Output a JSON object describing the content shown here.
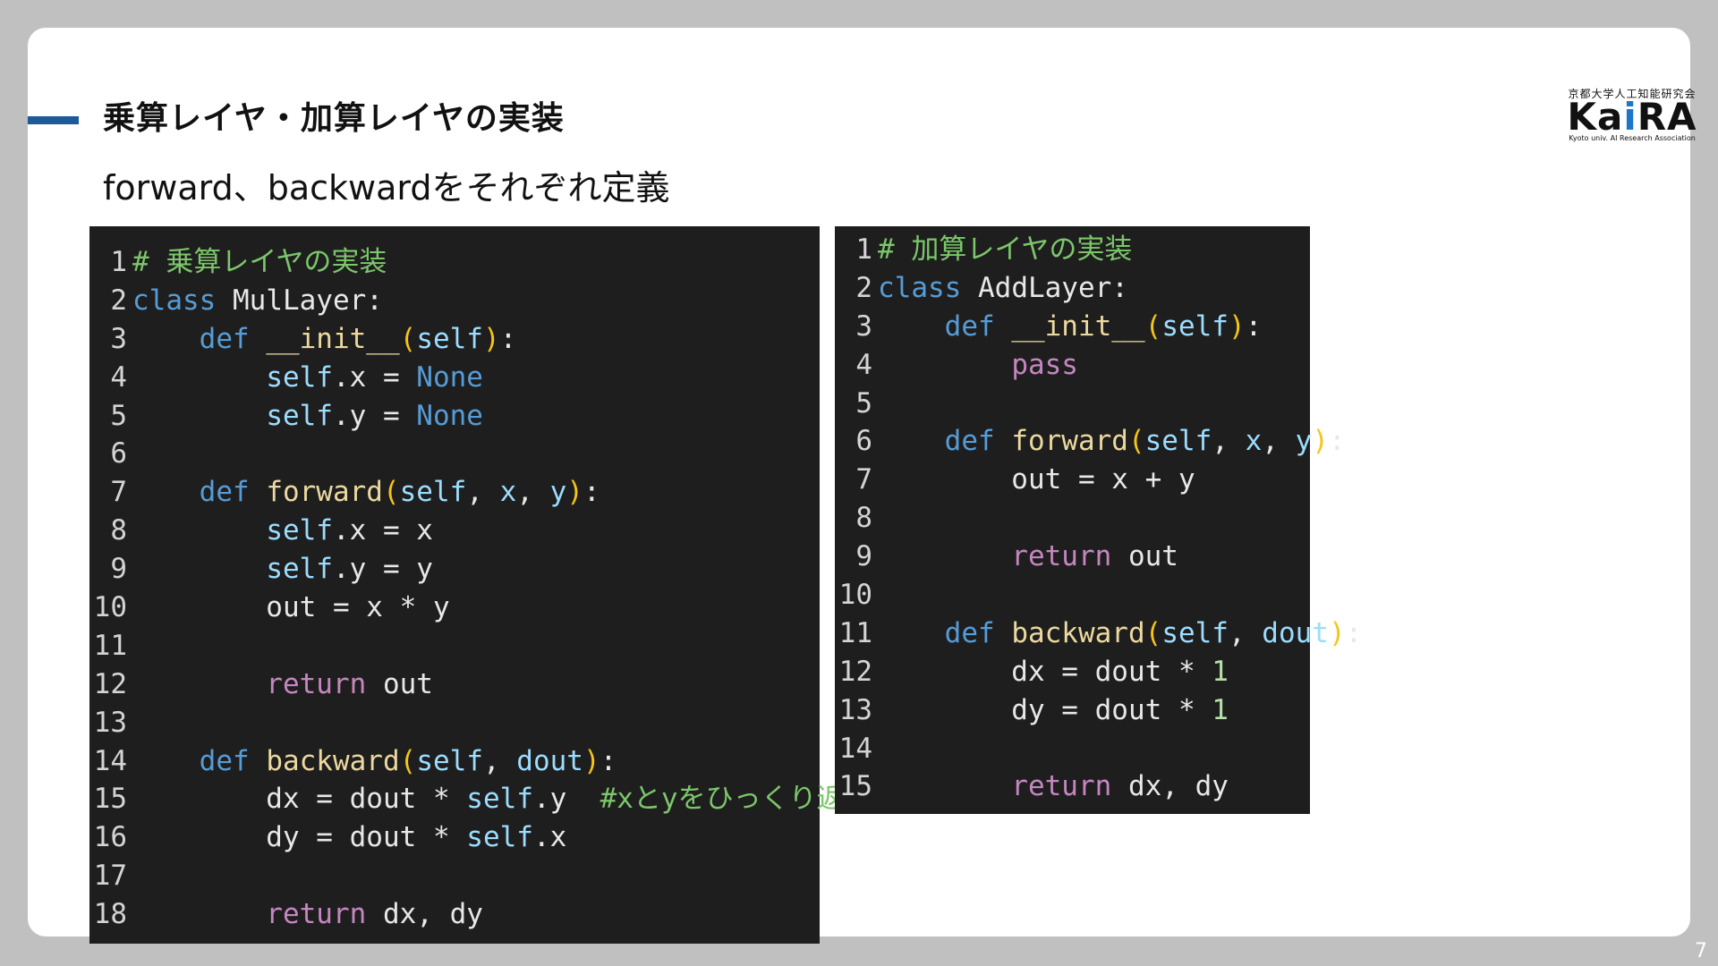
{
  "slide": {
    "title": "乗算レイヤ・加算レイヤの実装",
    "subtitle": "forward、backwardをそれぞれ定義",
    "page_number": "7"
  },
  "logo": {
    "japanese": "京都大学人工知能研究会",
    "main_left": "Ka",
    "main_i": "i",
    "main_right": "RA",
    "english": "Kyoto univ. AI Research Association",
    "accent_color": "#1d78c8"
  },
  "colors": {
    "accent_bar": "#1d5a96",
    "code_background": "#1e1e1e"
  },
  "code_left": {
    "lines": [
      {
        "n": "1",
        "tokens": [
          {
            "t": "# 乗算レイヤの実装",
            "c": "cmt"
          }
        ]
      },
      {
        "n": "2",
        "tokens": [
          {
            "t": "class",
            "c": "kw"
          },
          {
            "t": " MulLayer:",
            "c": "plain"
          }
        ]
      },
      {
        "n": "3",
        "tokens": [
          {
            "t": "    ",
            "c": "plain"
          },
          {
            "t": "def",
            "c": "kw"
          },
          {
            "t": " __init__",
            "c": "fn"
          },
          {
            "t": "(",
            "c": "paren"
          },
          {
            "t": "self",
            "c": "self"
          },
          {
            "t": ")",
            "c": "paren"
          },
          {
            "t": ":",
            "c": "plain"
          }
        ]
      },
      {
        "n": "4",
        "tokens": [
          {
            "t": "        ",
            "c": "plain"
          },
          {
            "t": "self",
            "c": "self"
          },
          {
            "t": ".x = ",
            "c": "plain"
          },
          {
            "t": "None",
            "c": "const"
          }
        ]
      },
      {
        "n": "5",
        "tokens": [
          {
            "t": "        ",
            "c": "plain"
          },
          {
            "t": "self",
            "c": "self"
          },
          {
            "t": ".y = ",
            "c": "plain"
          },
          {
            "t": "None",
            "c": "const"
          }
        ]
      },
      {
        "n": "6",
        "tokens": []
      },
      {
        "n": "7",
        "tokens": [
          {
            "t": "    ",
            "c": "plain"
          },
          {
            "t": "def",
            "c": "kw"
          },
          {
            "t": " forward",
            "c": "fn"
          },
          {
            "t": "(",
            "c": "paren"
          },
          {
            "t": "self",
            "c": "self"
          },
          {
            "t": ", ",
            "c": "plain"
          },
          {
            "t": "x",
            "c": "self"
          },
          {
            "t": ", ",
            "c": "plain"
          },
          {
            "t": "y",
            "c": "self"
          },
          {
            "t": ")",
            "c": "paren"
          },
          {
            "t": ":",
            "c": "plain"
          }
        ]
      },
      {
        "n": "8",
        "tokens": [
          {
            "t": "        ",
            "c": "plain"
          },
          {
            "t": "self",
            "c": "self"
          },
          {
            "t": ".x = x",
            "c": "plain"
          }
        ]
      },
      {
        "n": "9",
        "tokens": [
          {
            "t": "        ",
            "c": "plain"
          },
          {
            "t": "self",
            "c": "self"
          },
          {
            "t": ".y = y",
            "c": "plain"
          }
        ]
      },
      {
        "n": "10",
        "tokens": [
          {
            "t": "        out = x * y",
            "c": "plain"
          }
        ]
      },
      {
        "n": "11",
        "tokens": []
      },
      {
        "n": "12",
        "tokens": [
          {
            "t": "        ",
            "c": "plain"
          },
          {
            "t": "return",
            "c": "ctrl"
          },
          {
            "t": " out",
            "c": "plain"
          }
        ]
      },
      {
        "n": "13",
        "tokens": []
      },
      {
        "n": "14",
        "tokens": [
          {
            "t": "    ",
            "c": "plain"
          },
          {
            "t": "def",
            "c": "kw"
          },
          {
            "t": " backward",
            "c": "fn"
          },
          {
            "t": "(",
            "c": "paren"
          },
          {
            "t": "self",
            "c": "self"
          },
          {
            "t": ", ",
            "c": "plain"
          },
          {
            "t": "dout",
            "c": "self"
          },
          {
            "t": ")",
            "c": "paren"
          },
          {
            "t": ":",
            "c": "plain"
          }
        ]
      },
      {
        "n": "15",
        "tokens": [
          {
            "t": "        dx = dout * ",
            "c": "plain"
          },
          {
            "t": "self",
            "c": "self"
          },
          {
            "t": ".y  ",
            "c": "plain"
          },
          {
            "t": "#xとyをひっくり返す",
            "c": "cmt"
          }
        ]
      },
      {
        "n": "16",
        "tokens": [
          {
            "t": "        dy = dout * ",
            "c": "plain"
          },
          {
            "t": "self",
            "c": "self"
          },
          {
            "t": ".x",
            "c": "plain"
          }
        ]
      },
      {
        "n": "17",
        "tokens": []
      },
      {
        "n": "18",
        "tokens": [
          {
            "t": "        ",
            "c": "plain"
          },
          {
            "t": "return",
            "c": "ctrl"
          },
          {
            "t": " dx, dy",
            "c": "plain"
          }
        ]
      }
    ]
  },
  "code_right": {
    "lines": [
      {
        "n": "1",
        "tokens": [
          {
            "t": "# 加算レイヤの実装",
            "c": "cmt"
          }
        ]
      },
      {
        "n": "2",
        "tokens": [
          {
            "t": "class",
            "c": "kw"
          },
          {
            "t": " AddLayer:",
            "c": "plain"
          }
        ]
      },
      {
        "n": "3",
        "tokens": [
          {
            "t": "    ",
            "c": "plain"
          },
          {
            "t": "def",
            "c": "kw"
          },
          {
            "t": " __init__",
            "c": "fn"
          },
          {
            "t": "(",
            "c": "paren"
          },
          {
            "t": "self",
            "c": "self"
          },
          {
            "t": ")",
            "c": "paren"
          },
          {
            "t": ":",
            "c": "plain"
          }
        ]
      },
      {
        "n": "4",
        "tokens": [
          {
            "t": "        ",
            "c": "plain"
          },
          {
            "t": "pass",
            "c": "ctrl"
          }
        ]
      },
      {
        "n": "5",
        "tokens": []
      },
      {
        "n": "6",
        "tokens": [
          {
            "t": "    ",
            "c": "plain"
          },
          {
            "t": "def",
            "c": "kw"
          },
          {
            "t": " forward",
            "c": "fn"
          },
          {
            "t": "(",
            "c": "paren"
          },
          {
            "t": "self",
            "c": "self"
          },
          {
            "t": ", ",
            "c": "plain"
          },
          {
            "t": "x",
            "c": "self"
          },
          {
            "t": ", ",
            "c": "plain"
          },
          {
            "t": "y",
            "c": "self"
          },
          {
            "t": ")",
            "c": "paren"
          },
          {
            "t": ":",
            "c": "plain"
          }
        ]
      },
      {
        "n": "7",
        "tokens": [
          {
            "t": "        out = x + y",
            "c": "plain"
          }
        ]
      },
      {
        "n": "8",
        "tokens": []
      },
      {
        "n": "9",
        "tokens": [
          {
            "t": "        ",
            "c": "plain"
          },
          {
            "t": "return",
            "c": "ctrl"
          },
          {
            "t": " out",
            "c": "plain"
          }
        ]
      },
      {
        "n": "10",
        "tokens": []
      },
      {
        "n": "11",
        "tokens": [
          {
            "t": "    ",
            "c": "plain"
          },
          {
            "t": "def",
            "c": "kw"
          },
          {
            "t": " backward",
            "c": "fn"
          },
          {
            "t": "(",
            "c": "paren"
          },
          {
            "t": "self",
            "c": "self"
          },
          {
            "t": ", ",
            "c": "plain"
          },
          {
            "t": "dout",
            "c": "self"
          },
          {
            "t": ")",
            "c": "paren"
          },
          {
            "t": ":",
            "c": "plain"
          }
        ]
      },
      {
        "n": "12",
        "tokens": [
          {
            "t": "        dx = dout * ",
            "c": "plain"
          },
          {
            "t": "1",
            "c": "num"
          }
        ]
      },
      {
        "n": "13",
        "tokens": [
          {
            "t": "        dy = dout * ",
            "c": "plain"
          },
          {
            "t": "1",
            "c": "num"
          }
        ]
      },
      {
        "n": "14",
        "tokens": []
      },
      {
        "n": "15",
        "tokens": [
          {
            "t": "        ",
            "c": "plain"
          },
          {
            "t": "return",
            "c": "ctrl"
          },
          {
            "t": " dx, dy",
            "c": "plain"
          }
        ]
      }
    ]
  }
}
